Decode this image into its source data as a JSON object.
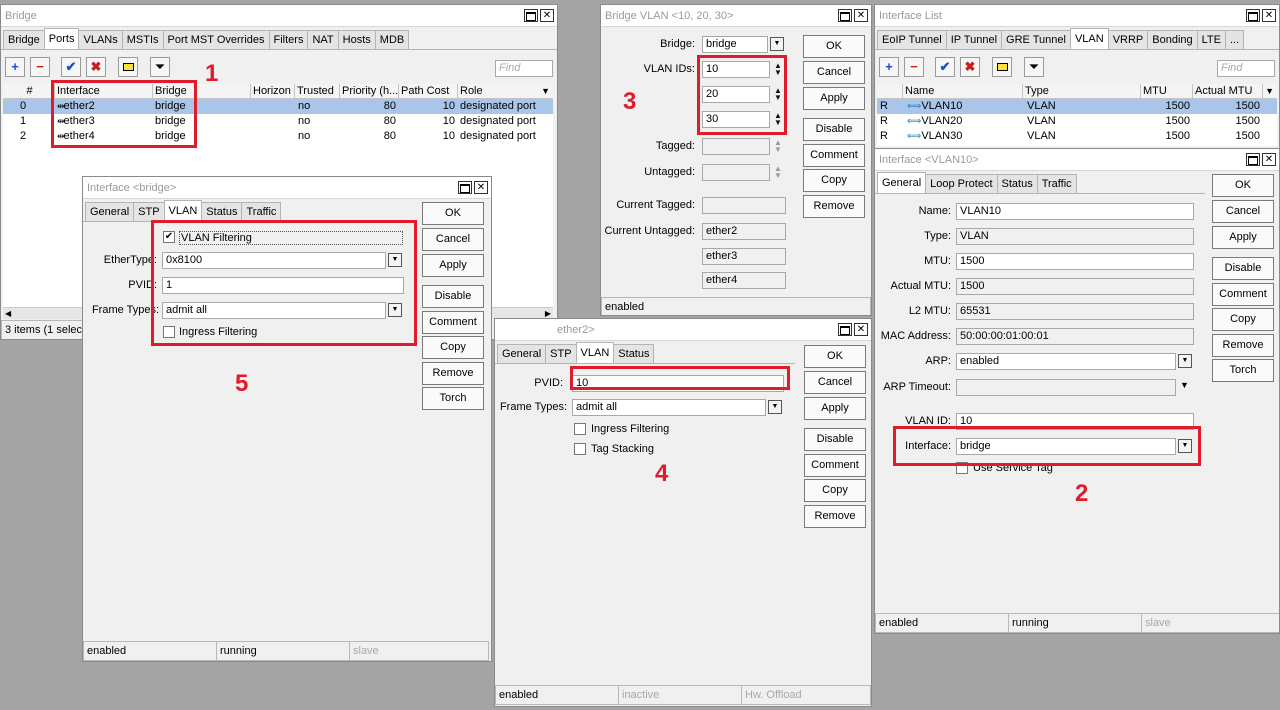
{
  "colors": {
    "annotation_red": "#e01b2b",
    "selected_row": "#a9c6ea",
    "add_blue": "#1a4fcf",
    "remove_red": "#c81e1e"
  },
  "icons": {
    "add": "plus-icon",
    "remove": "minus-icon",
    "enable": "check-icon",
    "disable": "x-icon",
    "comment": "comment-icon",
    "filter": "filter-icon"
  },
  "annotations": [
    "1",
    "2",
    "3",
    "4",
    "5"
  ],
  "common": {
    "ok": "OK",
    "cancel": "Cancel",
    "apply": "Apply",
    "disable": "Disable",
    "comment": "Comment",
    "copy": "Copy",
    "remove": "Remove",
    "torch": "Torch",
    "find": "Find"
  },
  "bridge": {
    "title": "Bridge",
    "tabs": [
      "Bridge",
      "Ports",
      "VLANs",
      "MSTIs",
      "Port MST Overrides",
      "Filters",
      "NAT",
      "Hosts",
      "MDB"
    ],
    "columns": [
      "#",
      "Interface",
      "Bridge",
      "Horizon",
      "Trusted",
      "Priority (h...",
      "Path Cost",
      "Role"
    ],
    "rows": [
      {
        "num": "0",
        "interface": "ether2",
        "bridge": "bridge",
        "horizon": "",
        "trusted": "no",
        "priority": "80",
        "path_cost": "10",
        "role": "designated port"
      },
      {
        "num": "1",
        "interface": "ether3",
        "bridge": "bridge",
        "horizon": "",
        "trusted": "no",
        "priority": "80",
        "path_cost": "10",
        "role": "designated port"
      },
      {
        "num": "2",
        "interface": "ether4",
        "bridge": "bridge",
        "horizon": "",
        "trusted": "no",
        "priority": "80",
        "path_cost": "10",
        "role": "designated port"
      }
    ],
    "status": "3 items (1 selecte"
  },
  "iface_bridge": {
    "title": "Interface <bridge>",
    "tabs": [
      "General",
      "STP",
      "VLAN",
      "Status",
      "Traffic"
    ],
    "vlan_filtering": "VLAN Filtering",
    "ethertype_label": "EtherType:",
    "ethertype": "0x8100",
    "pvid_label": "PVID:",
    "pvid": "1",
    "frame_types_label": "Frame Types:",
    "frame_types": "admit all",
    "ingress_filtering": "Ingress Filtering",
    "status": [
      "enabled",
      "running",
      "slave"
    ]
  },
  "bridge_vlan": {
    "title": "Bridge VLAN <10, 20, 30>",
    "bridge_label": "Bridge:",
    "bridge": "bridge",
    "vlan_ids_label": "VLAN IDs:",
    "vlan_ids": [
      "10",
      "20",
      "30"
    ],
    "tagged_label": "Tagged:",
    "untagged_label": "Untagged:",
    "current_tagged_label": "Current Tagged:",
    "current_untagged_label": "Current Untagged:",
    "current_untagged": [
      "ether2",
      "ether3",
      "ether4"
    ],
    "status": "enabled"
  },
  "iface_ether2": {
    "title": "ether2>",
    "tabs": [
      "General",
      "STP",
      "VLAN",
      "Status"
    ],
    "pvid_label": "PVID:",
    "pvid": "10",
    "frame_types_label": "Frame Types:",
    "frame_types": "admit all",
    "ingress_filtering": "Ingress Filtering",
    "tag_stacking": "Tag Stacking",
    "status": [
      "enabled",
      "inactive",
      "Hw. Offload"
    ]
  },
  "iface_list": {
    "title": "Interface List",
    "tabs": [
      "EoIP Tunnel",
      "IP Tunnel",
      "GRE Tunnel",
      "VLAN",
      "VRRP",
      "Bonding",
      "LTE",
      "..."
    ],
    "columns": [
      "Name",
      "Type",
      "MTU",
      "Actual MTU"
    ],
    "rows": [
      {
        "flag": "R",
        "name": "VLAN10",
        "type": "VLAN",
        "mtu": "1500",
        "actual_mtu": "1500"
      },
      {
        "flag": "R",
        "name": "VLAN20",
        "type": "VLAN",
        "mtu": "1500",
        "actual_mtu": "1500"
      },
      {
        "flag": "R",
        "name": "VLAN30",
        "type": "VLAN",
        "mtu": "1500",
        "actual_mtu": "1500"
      }
    ]
  },
  "iface_vlan10": {
    "title": "Interface <VLAN10>",
    "tabs": [
      "General",
      "Loop Protect",
      "Status",
      "Traffic"
    ],
    "name_label": "Name:",
    "name": "VLAN10",
    "type_label": "Type:",
    "type": "VLAN",
    "mtu_label": "MTU:",
    "mtu": "1500",
    "actual_mtu_label": "Actual MTU:",
    "actual_mtu": "1500",
    "l2mtu_label": "L2 MTU:",
    "l2mtu": "65531",
    "mac_label": "MAC Address:",
    "mac": "50:00:00:01:00:01",
    "arp_label": "ARP:",
    "arp": "enabled",
    "arp_timeout_label": "ARP Timeout:",
    "vlan_id_label": "VLAN ID:",
    "vlan_id": "10",
    "interface_label": "Interface:",
    "interface": "bridge",
    "service_tag": "Use Service Tag",
    "status": [
      "enabled",
      "running",
      "slave"
    ]
  }
}
